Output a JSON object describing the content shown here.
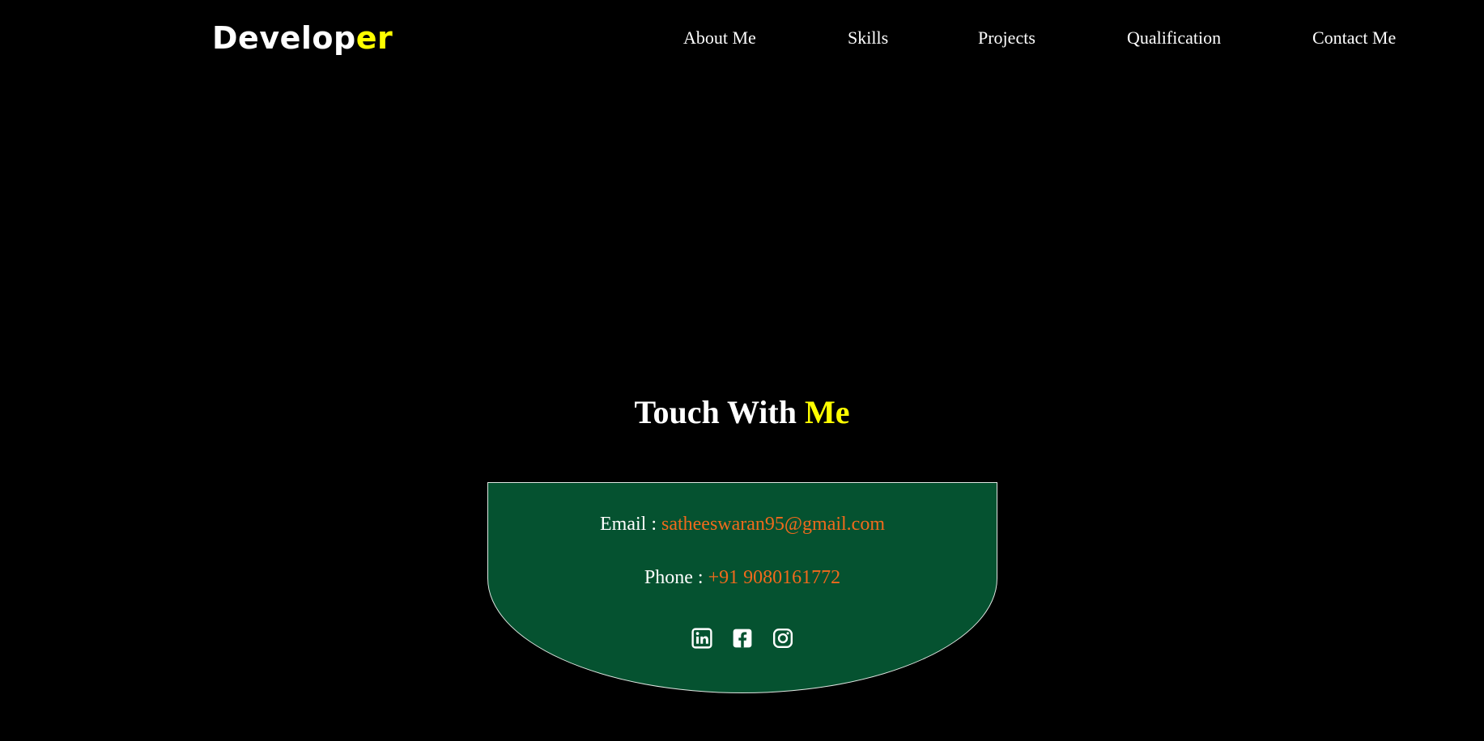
{
  "header": {
    "logo_main": "Develop",
    "logo_accent": "er",
    "nav": [
      "About Me",
      "Skills",
      "Projects",
      "Qualification",
      "Contact Me"
    ]
  },
  "contact": {
    "title_main": "Touch With ",
    "title_accent": "Me",
    "email_label": "Email : ",
    "email_value": "satheeswaran95@gmail.com",
    "phone_label": "Phone : ",
    "phone_value": "+91 9080161772",
    "socials": [
      "linkedin-icon",
      "facebook-icon",
      "instagram-icon"
    ]
  },
  "colors": {
    "background": "#000000",
    "accent": "#ffff00",
    "card": "#055230",
    "link": "#f06a1c"
  }
}
